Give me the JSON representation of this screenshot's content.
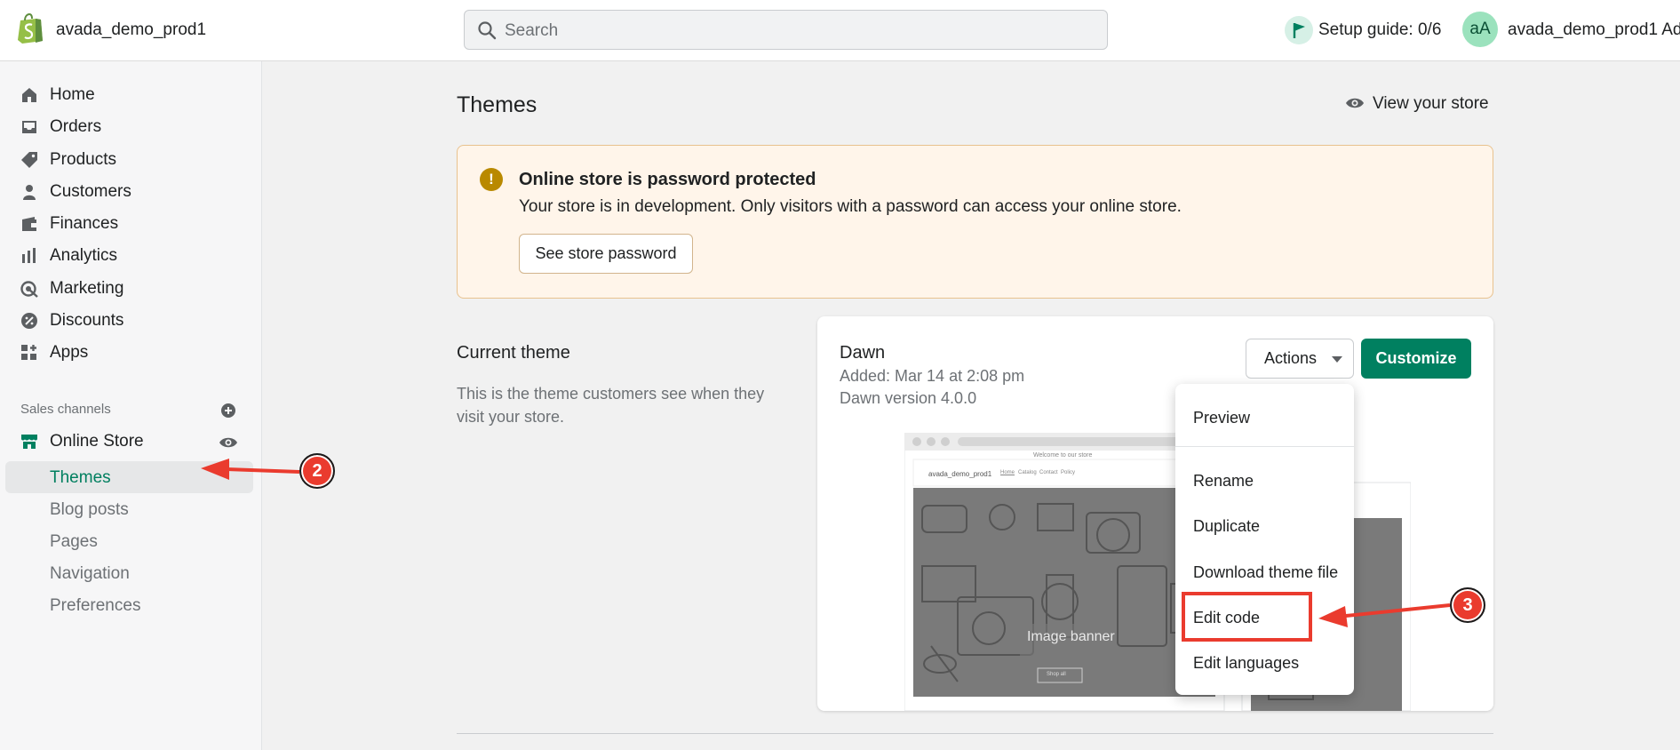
{
  "topbar": {
    "store_name": "avada_demo_prod1",
    "search_placeholder": "Search",
    "setup_guide": "Setup guide: 0/6",
    "avatar_initials": "aA",
    "account_name": "avada_demo_prod1 Ad..."
  },
  "sidebar": {
    "items": [
      {
        "label": "Home",
        "icon": "home-icon"
      },
      {
        "label": "Orders",
        "icon": "orders-icon"
      },
      {
        "label": "Products",
        "icon": "tag-icon"
      },
      {
        "label": "Customers",
        "icon": "person-icon"
      },
      {
        "label": "Finances",
        "icon": "wallet-icon"
      },
      {
        "label": "Analytics",
        "icon": "bar-chart-icon"
      },
      {
        "label": "Marketing",
        "icon": "target-icon"
      },
      {
        "label": "Discounts",
        "icon": "discount-icon"
      },
      {
        "label": "Apps",
        "icon": "apps-icon"
      }
    ],
    "sales_channels_label": "Sales channels",
    "online_store_label": "Online Store",
    "sub_items": [
      {
        "label": "Themes",
        "active": true
      },
      {
        "label": "Blog posts",
        "active": false
      },
      {
        "label": "Pages",
        "active": false
      },
      {
        "label": "Navigation",
        "active": false
      },
      {
        "label": "Preferences",
        "active": false
      }
    ]
  },
  "main": {
    "title": "Themes",
    "view_store": "View your store",
    "banner": {
      "title": "Online store is password protected",
      "text": "Your store is in development. Only visitors with a password can access your online store.",
      "button": "See store password"
    },
    "current_theme_heading": "Current theme",
    "current_theme_desc": "This is the theme customers see when they visit your store.",
    "theme": {
      "name": "Dawn",
      "added": "Added: Mar 14 at 2:08 pm",
      "version": "Dawn version 4.0.0",
      "actions_label": "Actions",
      "customize_label": "Customize"
    },
    "preview": {
      "announcement": "Welcome to our store",
      "store_name": "avada_demo_prod1",
      "nav_links": [
        "Home",
        "Catalog",
        "Contact",
        "Policy"
      ],
      "image_banner": "Image banner",
      "banner_button": "Shop all"
    },
    "dropdown_items": [
      "Preview",
      "Rename",
      "Duplicate",
      "Download theme file",
      "Edit code",
      "Edit languages"
    ]
  },
  "annotations": {
    "step_2": "2",
    "step_3": "3"
  },
  "colors": {
    "brand_green": "#008060",
    "active_green": "#007f5f",
    "warning": "#b98900",
    "annotation_red": "#ea3b2e"
  }
}
